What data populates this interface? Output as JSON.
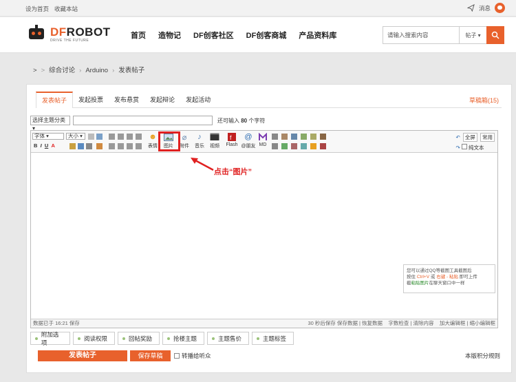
{
  "topbar": {
    "set_home": "设为首页",
    "bookmark": "收藏本站",
    "messages": "消息"
  },
  "logo": {
    "brand_df": "DF",
    "brand_robot": "ROBOT",
    "tagline": "DRIVE THE FUTURE"
  },
  "nav": {
    "items": [
      "首页",
      "造物记",
      "DF创客社区",
      "DF创客商城",
      "产品资料库"
    ]
  },
  "search": {
    "placeholder": "请输入搜索内容",
    "scope": "帖子 ▾"
  },
  "breadcrumb": {
    "a": ">",
    "b": ">",
    "c": "综合讨论",
    "d": "Arduino",
    "e": "发表帖子"
  },
  "tabs": [
    "发表帖子",
    "发起投票",
    "发布悬赏",
    "发起辩论",
    "发起活动"
  ],
  "draft_box": "草稿箱(15)",
  "category": {
    "select": "选择主题分类 ▾",
    "counter_pre": "还可输入",
    "counter_num": "80",
    "counter_post": "个字符"
  },
  "toolbar": {
    "font": "字体 ▾",
    "size": "大小 ▾",
    "emoji": "表情",
    "image": "图片",
    "attach": "附件",
    "music": "音乐",
    "video": "视频",
    "flash": "Flash",
    "mention": "@朋友",
    "md": "MD",
    "fullscreen": "全屏",
    "common": "常用",
    "plaintext": "纯文本"
  },
  "hint": {
    "line1": "您可以通过QQ等截图工具截图后",
    "line2a": "按住",
    "line2b": "Ctrl+V",
    "line2c": "或",
    "line2d": "右键 - 粘贴",
    "line2e": "即可上传",
    "line3a": "截",
    "line3b": "粘贴图片",
    "line3c": "在聊天窗口中一样"
  },
  "statusbar": {
    "saved": "数据已于 16:21 保存",
    "autosave": "30 秒后保存 保存数据 | 恢复数据",
    "tools": "字数检查 | 清除内容",
    "resize": "加大编辑框 | 缩小编辑框"
  },
  "annotation": {
    "label": "点击“图片”"
  },
  "options": [
    "附加选项",
    "阅读权限",
    "回帖奖励",
    "抢楼主题",
    "主题售价",
    "主题标签"
  ],
  "actions": {
    "submit": "发表帖子",
    "save_draft": "保存草稿",
    "forward": "转播给听众",
    "rules": "本版积分规则"
  },
  "colors": {
    "accent": "#e8612c",
    "highlight": "#e02020"
  }
}
